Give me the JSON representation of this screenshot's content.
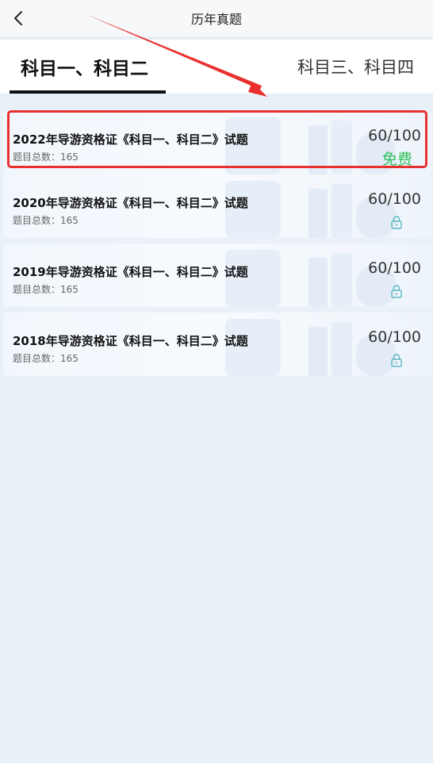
{
  "header": {
    "title": "历年真题",
    "back_icon": "chevron-left-icon"
  },
  "tabs": [
    {
      "label": "科目一、科目二",
      "active": true
    },
    {
      "label": "科目三、科目四",
      "active": false
    }
  ],
  "papers": [
    {
      "title": "2022年导游资格证《科目一、科目二》试题",
      "count_label": "题目总数：",
      "count": "165",
      "score": "60/100",
      "status": "免费"
    },
    {
      "title": "2020年导游资格证《科目一、科目二》试题",
      "count_label": "题目总数：",
      "count": "165",
      "score": "60/100",
      "status_icon": "lock-icon"
    },
    {
      "title": "2019年导游资格证《科目一、科目二》试题",
      "count_label": "题目总数：",
      "count": "165",
      "score": "60/100",
      "status_icon": "lock-icon"
    },
    {
      "title": "2018年导游资格证《科目一、科目二》试题",
      "count_label": "题目总数：",
      "count": "165",
      "score": "60/100",
      "status_icon": "lock-icon"
    }
  ],
  "colors": {
    "background": "#eaf0f8",
    "free": "#2ec05a",
    "lock": "#5bb8c4",
    "annotation": "#e8302f"
  }
}
